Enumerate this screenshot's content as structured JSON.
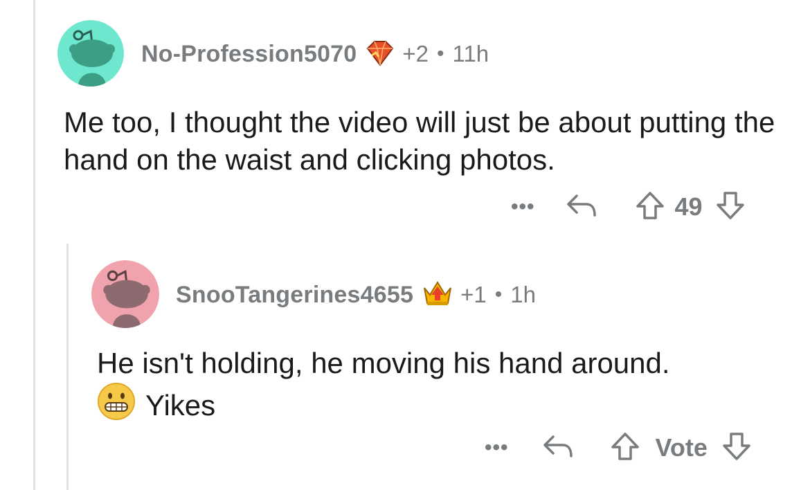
{
  "comments": [
    {
      "username": "No-Profession5070",
      "award_icon": "ruby-gem-award-icon",
      "award_count": "+2",
      "separator": "•",
      "time": "11h",
      "avatar_color": "#6ee7cf",
      "avatar_figure_color": "#3d9e86",
      "body": "Me too, I thought the video will just be about putting the hand on the waist and clicking photos.",
      "actions": {
        "more": "•••",
        "score": "49"
      }
    },
    {
      "username": "SnooTangerines4655",
      "award_icon": "gold-crown-arrow-award-icon",
      "award_count": "+1",
      "separator": "•",
      "time": "1h",
      "avatar_color": "#f0a3ad",
      "avatar_figure_color": "#8c6a6f",
      "body_emoji": "grimacing-face-icon",
      "body_line1": "He isn't holding, he moving his hand around.",
      "body_line2": "Yikes",
      "actions": {
        "more": "•••",
        "vote_label": "Vote"
      }
    }
  ],
  "colors": {
    "meta_gray": "#787c7e",
    "text": "#1a1a1b",
    "thread_line": "#e2e2e4"
  }
}
